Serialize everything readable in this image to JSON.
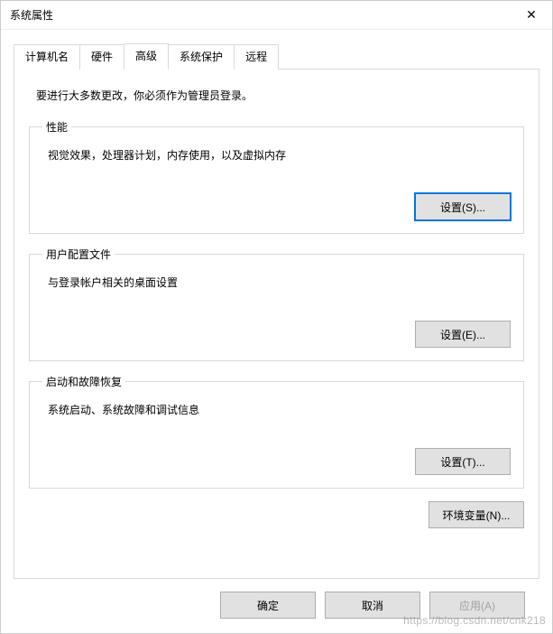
{
  "window": {
    "title": "系统属性",
    "close_glyph": "✕"
  },
  "tabs": [
    {
      "label": "计算机名"
    },
    {
      "label": "硬件"
    },
    {
      "label": "高级"
    },
    {
      "label": "系统保护"
    },
    {
      "label": "远程"
    }
  ],
  "active_tab_index": 2,
  "panel": {
    "intro": "要进行大多数更改，你必须作为管理员登录。",
    "groups": [
      {
        "legend": "性能",
        "desc": "视觉效果，处理器计划，内存使用，以及虚拟内存",
        "button": "设置(S)...",
        "button_focus": true
      },
      {
        "legend": "用户配置文件",
        "desc": "与登录帐户相关的桌面设置",
        "button": "设置(E)...",
        "button_focus": false
      },
      {
        "legend": "启动和故障恢复",
        "desc": "系统启动、系统故障和调试信息",
        "button": "设置(T)...",
        "button_focus": false
      }
    ],
    "env_button": "环境变量(N)..."
  },
  "dialog_buttons": {
    "ok": "确定",
    "cancel": "取消",
    "apply": "应用(A)",
    "apply_disabled": true
  },
  "watermark": "https://blog.csdn.net/cnk218"
}
